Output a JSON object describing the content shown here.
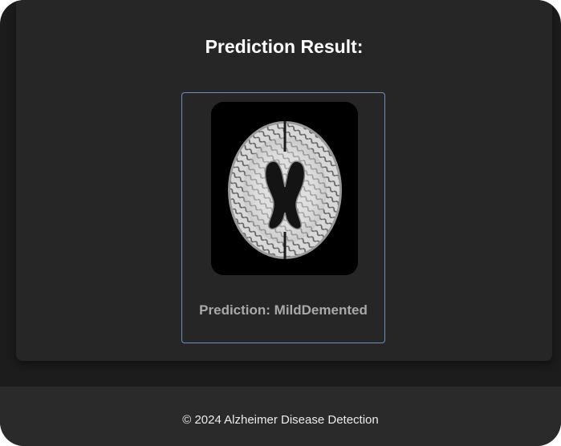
{
  "main": {
    "title": "Prediction Result:",
    "result": {
      "image_alt": "MRI brain scan",
      "prediction_label": "Prediction: MildDemented",
      "card_border_color": "#6d8fc4"
    }
  },
  "footer": {
    "text": "© 2024 Alzheimer Disease Detection"
  },
  "colors": {
    "page_bg": "#1c1c1d",
    "card_bg": "#262627",
    "title_color": "#ffffff",
    "prediction_color": "#a8a9ab"
  }
}
